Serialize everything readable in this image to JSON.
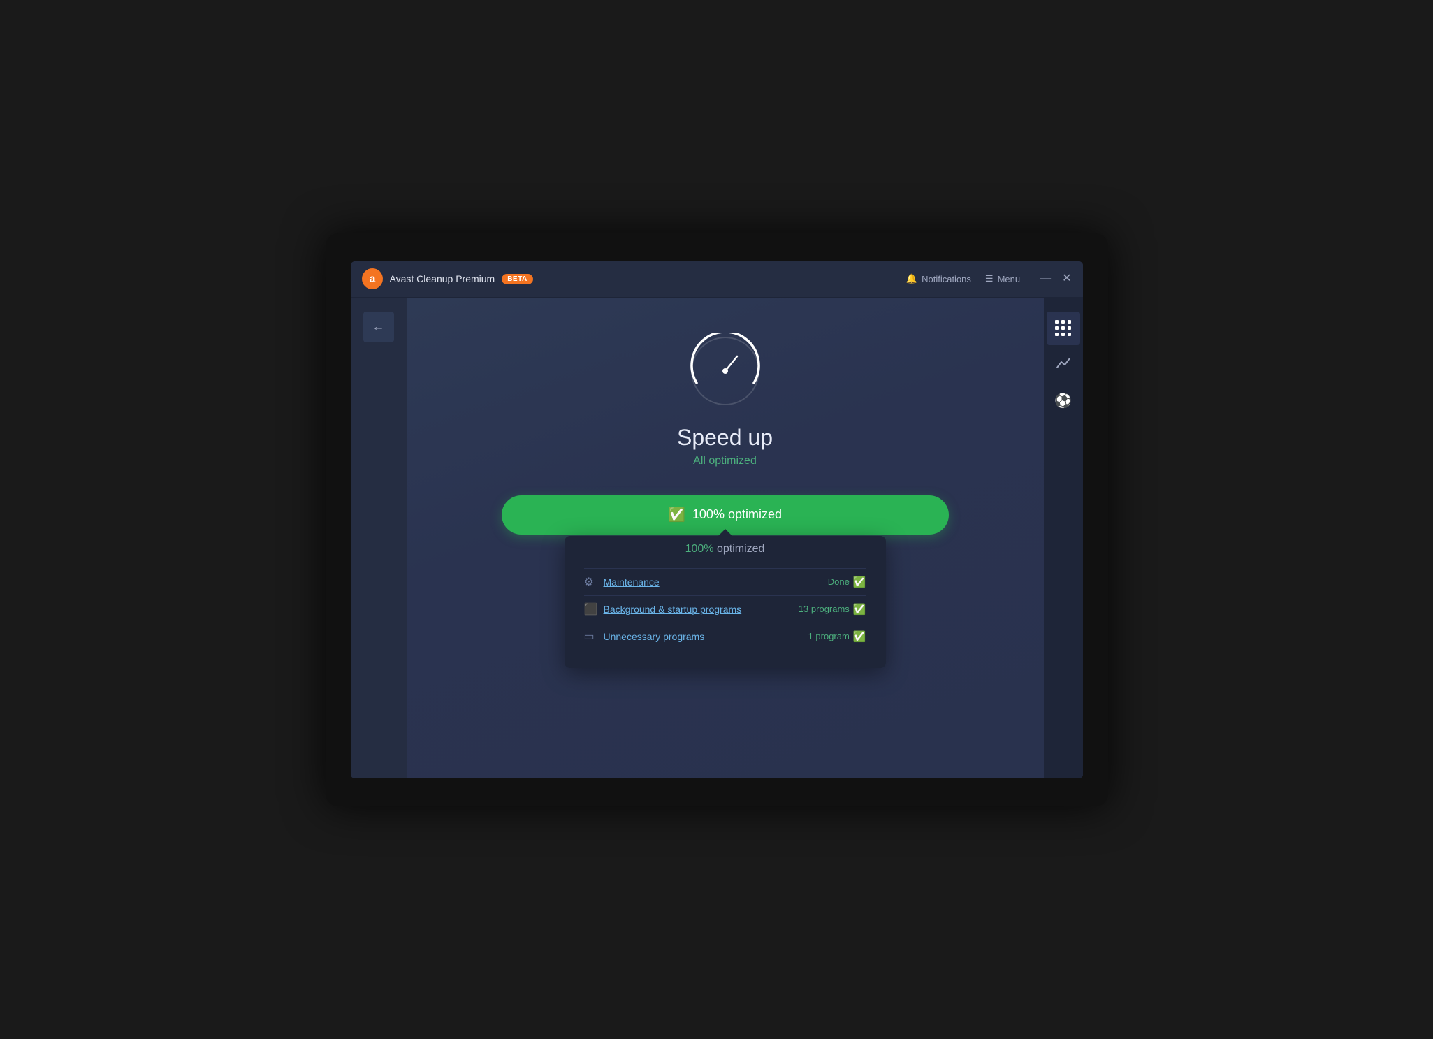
{
  "titleBar": {
    "appTitle": "Avast Cleanup Premium",
    "betaLabel": "BETA",
    "notifications": "Notifications",
    "menu": "Menu",
    "minimizeLabel": "—",
    "closeLabel": "✕"
  },
  "backButton": {
    "label": "←"
  },
  "speedup": {
    "title": "Speed up",
    "subtitle": "All optimized",
    "buttonLabel": "100% optimized"
  },
  "dropdownPanel": {
    "titlePrefix": "100%",
    "titleSuffix": " optimized",
    "items": [
      {
        "iconLabel": "maintenance-icon",
        "label": "Maintenance",
        "statusText": "Done",
        "statusIconLabel": "check-circle-icon"
      },
      {
        "iconLabel": "startup-icon",
        "label": "Background & startup programs",
        "statusText": "13 programs",
        "statusIconLabel": "check-circle-icon"
      },
      {
        "iconLabel": "programs-icon",
        "label": "Unnecessary programs",
        "statusText": "1 program",
        "statusIconLabel": "check-circle-icon"
      }
    ]
  },
  "rightSidebar": {
    "icons": [
      {
        "name": "grid-icon",
        "label": "⠿"
      },
      {
        "name": "chart-icon",
        "label": "📈"
      },
      {
        "name": "soccer-icon",
        "label": "⚽"
      }
    ]
  }
}
